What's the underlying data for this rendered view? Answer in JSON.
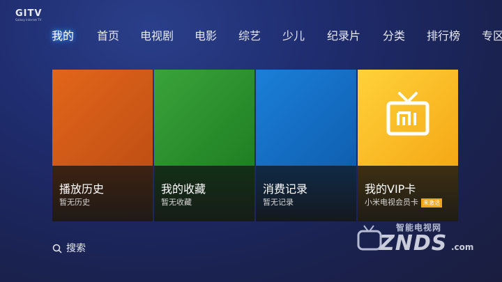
{
  "logo": {
    "mark": "GITV",
    "sub": "Galaxy Internet TV"
  },
  "nav": [
    {
      "label": "我的",
      "active": true
    },
    {
      "label": "首页"
    },
    {
      "label": "电视剧"
    },
    {
      "label": "电影"
    },
    {
      "label": "综艺"
    },
    {
      "label": "少儿"
    },
    {
      "label": "纪录片"
    },
    {
      "label": "分类"
    },
    {
      "label": "排行榜"
    },
    {
      "label": "专区"
    }
  ],
  "tiles": [
    {
      "title": "播放历史",
      "subtitle": "暂无历史",
      "color": "#d65c17"
    },
    {
      "title": "我的收藏",
      "subtitle": "暂无收藏",
      "color": "#2d9430"
    },
    {
      "title": "消费记录",
      "subtitle": "暂无记录",
      "color": "#1670c8"
    },
    {
      "title": "我的VIP卡",
      "subtitle": "小米电视会员卡",
      "badge": "未激活",
      "icon": "mi-tv-icon",
      "color": "#fbbf26"
    }
  ],
  "search": {
    "label": "搜索",
    "icon": "search-icon"
  },
  "watermark": {
    "top": "智能电视网",
    "main": "ZNDS",
    "suffix": ".com"
  }
}
